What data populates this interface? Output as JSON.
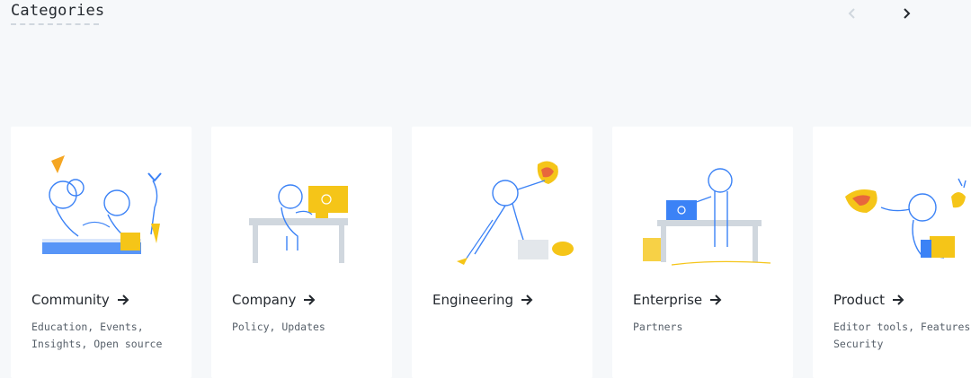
{
  "header": {
    "title": "Categories"
  },
  "nav": {
    "prev_icon": "chevron-left-icon",
    "next_icon": "chevron-right-icon"
  },
  "cards": [
    {
      "title": "Community",
      "tags": "Education, Events, Insights, Open source"
    },
    {
      "title": "Company",
      "tags": "Policy, Updates"
    },
    {
      "title": "Engineering",
      "tags": ""
    },
    {
      "title": "Enterprise",
      "tags": "Partners"
    },
    {
      "title": "Product",
      "tags": "Editor tools, Features, Security"
    }
  ],
  "colors": {
    "background": "#f6f8fa",
    "illustration_blue": "#3b82f6",
    "illustration_yellow": "#f5c518",
    "text": "#24292f",
    "muted": "#57606a"
  }
}
